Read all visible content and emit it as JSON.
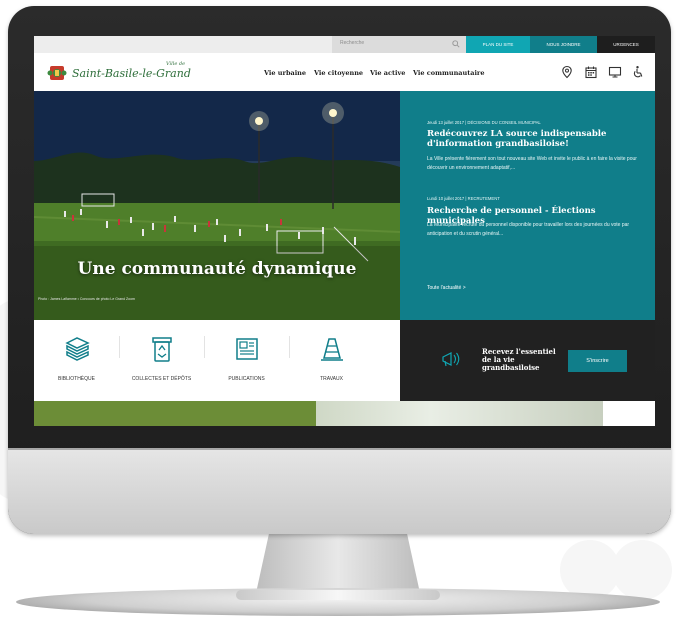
{
  "topbar": {
    "search_placeholder": "Recherche",
    "links": [
      "Plan du site",
      "Nous joindre",
      "Urgences"
    ],
    "link_colors": [
      "#10a6b3",
      "#107e8a",
      "#1e1e1e"
    ]
  },
  "header": {
    "logo_small": "Ville de",
    "logo_text": "Saint-Basile-le-Grand",
    "nav": [
      "Vie urbaine",
      "Vie citoyenne",
      "Vie active",
      "Vie communautaire"
    ],
    "icons": [
      "map-pin-icon",
      "calendar-icon",
      "monitor-icon",
      "accessibility-icon"
    ]
  },
  "hero": {
    "title": "Une communauté dynamique",
    "credit": "Photo : James Laflamme • Concours de photo Le Grand Zoom"
  },
  "news": {
    "items": [
      {
        "meta": "Jeudi 13 juillet 2017 | DÉCISIONS DU CONSEIL MUNICIPAL",
        "title": "Redécouvrez LA source indispensable d'information grandbasiloise!",
        "body": "La Ville présente fièrement son tout nouveau site Web et invite le public à en faire la visite pour découvrir un environnement adaptatif,..."
      },
      {
        "meta": "Lundi 10 juillet 2017 | RECRUTEMENT",
        "title": "Recherche de personnel - Élections municipales",
        "body": "La Municipalité recrute du personnel disponible pour travailler lors des journées du vote par anticipation et du scrutin général..."
      }
    ],
    "more": "Toute l'actualité >"
  },
  "services": [
    {
      "label": "Bibliothèque",
      "icon": "books-icon"
    },
    {
      "label": "Collectes et dépôts",
      "icon": "recycle-bin-icon"
    },
    {
      "label": "Publications",
      "icon": "newspaper-icon"
    },
    {
      "label": "Travaux",
      "icon": "traffic-cone-icon"
    }
  ],
  "newsletter": {
    "text": "Recevez l'essentiel de la vie grandbasiloise",
    "button": "S'inscrire",
    "icon": "megaphone-icon"
  },
  "colors": {
    "teal": "#107e8a",
    "teal_light": "#10a6b3",
    "logo_green": "#2e6e3a",
    "dark": "#212121"
  }
}
